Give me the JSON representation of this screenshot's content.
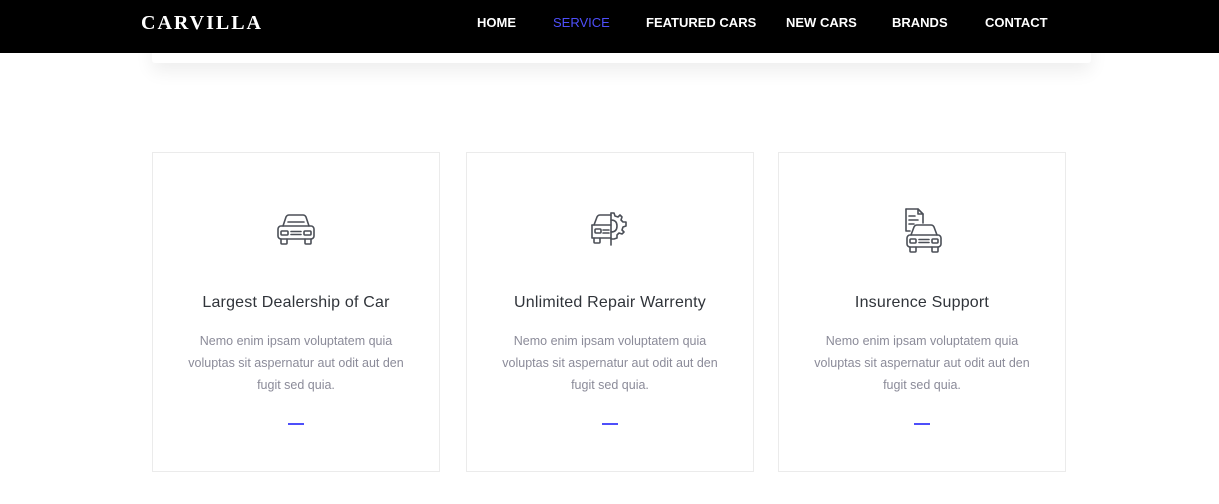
{
  "brand": {
    "name": "CARVILLA"
  },
  "nav": {
    "items": [
      {
        "label": "HOME",
        "active": false
      },
      {
        "label": "SERVICE",
        "active": true
      },
      {
        "label": "FEATURED CARS",
        "active": false
      },
      {
        "label": "NEW CARS",
        "active": false
      },
      {
        "label": "BRANDS",
        "active": false
      },
      {
        "label": "CONTACT",
        "active": false
      }
    ]
  },
  "colors": {
    "accent": "#4e4ffa",
    "navbar_bg": "#000000",
    "title_text": "#30343a",
    "body_text": "#8b8b99",
    "icon_stroke": "#4b4f57"
  },
  "services": [
    {
      "icon": "car-icon",
      "title": "Largest Dealership of Car",
      "text": "Nemo enim ipsam voluptatem quia voluptas sit aspernatur aut odit aut den fugit sed quia."
    },
    {
      "icon": "car-gear-icon",
      "title": "Unlimited Repair Warrenty",
      "text": "Nemo enim ipsam voluptatem quia voluptas sit aspernatur aut odit aut den fugit sed quia."
    },
    {
      "icon": "car-document-icon",
      "title": "Insurence Support",
      "text": "Nemo enim ipsam voluptatem quia voluptas sit aspernatur aut odit aut den fugit sed quia."
    }
  ]
}
